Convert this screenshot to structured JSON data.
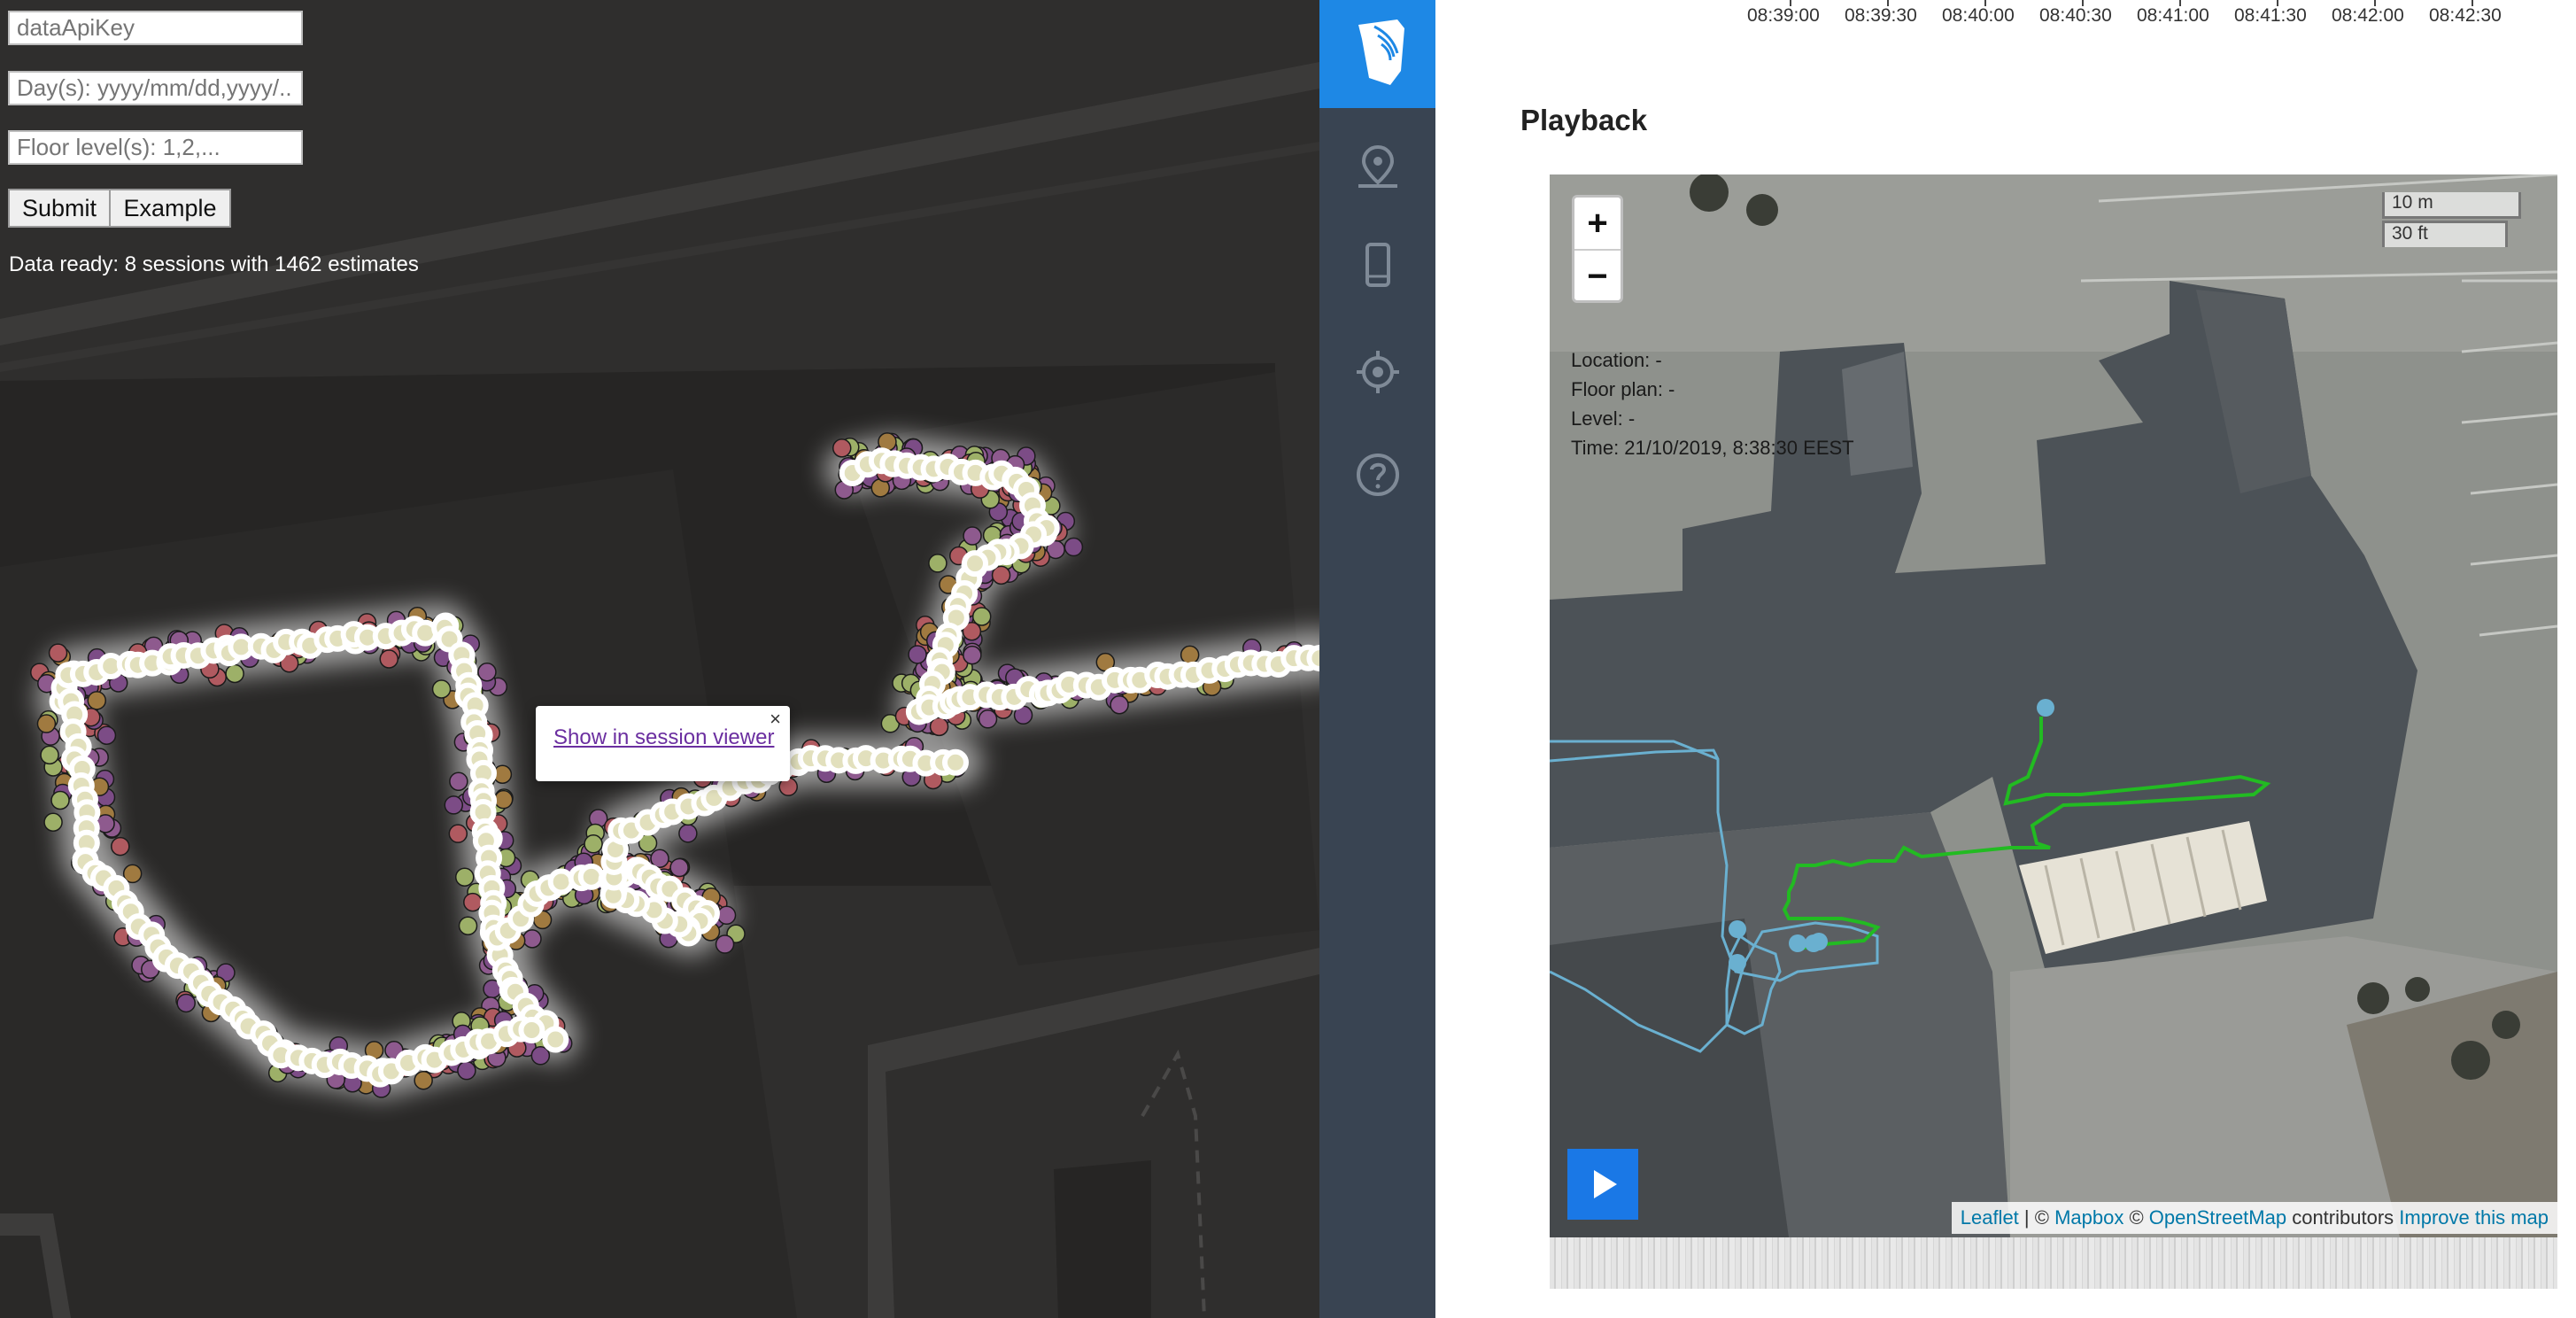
{
  "form": {
    "api_key_placeholder": "dataApiKey",
    "days_placeholder": "Day(s): yyyy/mm/dd,yyyy/...",
    "floors_placeholder": "Floor level(s): 1,2,...",
    "submit_label": "Submit",
    "example_label": "Example",
    "status": "Data ready: 8 sessions with 1462 estimates"
  },
  "popup": {
    "close_label": "×",
    "link_label": "Show in session viewer"
  },
  "sidebar": {
    "items": [
      {
        "icon": "logo-shield-icon",
        "active": true
      },
      {
        "icon": "map-pin-icon"
      },
      {
        "icon": "phone-icon"
      },
      {
        "icon": "crosshair-target-icon"
      },
      {
        "icon": "help-circle-icon"
      }
    ],
    "active_color": "#1e88e5",
    "bg_color": "#394452"
  },
  "timeline": {
    "ticks": [
      "08:39:00",
      "08:39:30",
      "08:40:00",
      "08:40:30",
      "08:41:00",
      "08:41:30",
      "08:42:00",
      "08:42:30"
    ]
  },
  "playback": {
    "title": "Playback",
    "zoom_in": "+",
    "zoom_out": "−",
    "scale_metric": "10 m",
    "scale_imperial": "30 ft",
    "location": "Location: -",
    "floor_plan": "Floor plan: -",
    "level": "Level: -",
    "time": "Time: 21/10/2019, 8:38:30 EEST",
    "attribution": {
      "leaflet": "Leaflet",
      "sep1": " | © ",
      "mapbox": "Mapbox",
      "sep2": " © ",
      "osm": "OpenStreetMap",
      "contributors": " contributors ",
      "improve": "Improve this map"
    },
    "track_colors": {
      "green": "#22bb22",
      "blue": "#6ab0d0"
    }
  }
}
